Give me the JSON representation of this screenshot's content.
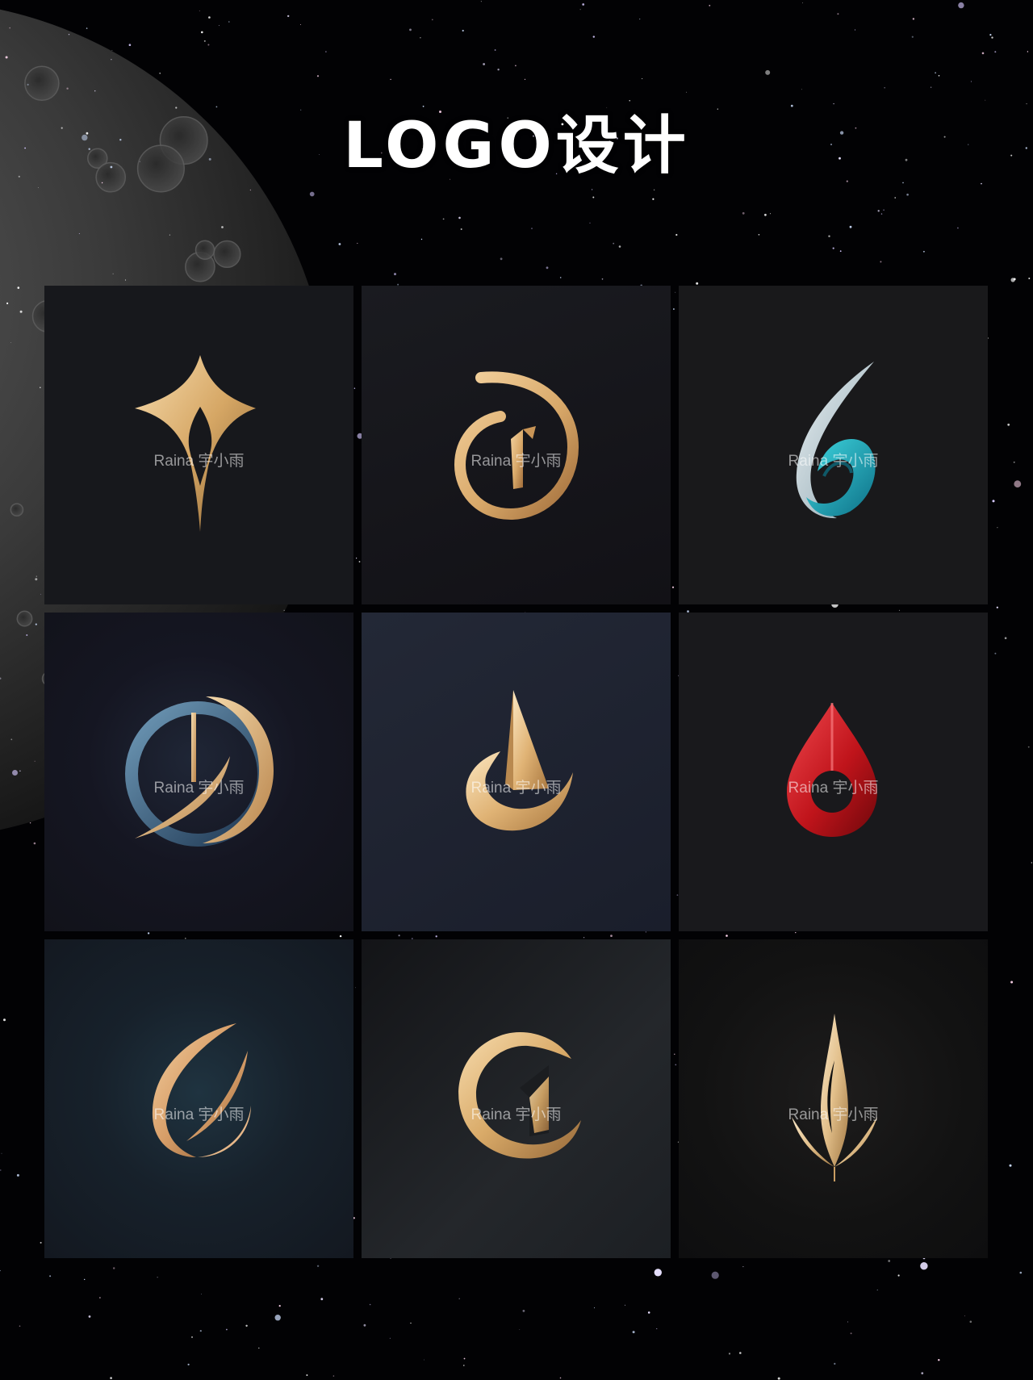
{
  "page": {
    "title": "LOGO设计",
    "watermark": "Raina 宇小雨"
  },
  "colors": {
    "background": "#020204",
    "title": "#ffffff",
    "gold": "#e2b67a",
    "teal": "#1fb3c0",
    "steel_blue": "#3f6a86",
    "red": "#c0141b"
  },
  "logos": [
    {
      "icon": "gold-diamond-leaf-icon"
    },
    {
      "icon": "gold-spiral-ring-icon"
    },
    {
      "icon": "silver-teal-droplet-icon"
    },
    {
      "icon": "blue-gold-ring-slash-icon"
    },
    {
      "icon": "gold-flag-crescent-icon"
    },
    {
      "icon": "red-droplet-icon"
    },
    {
      "icon": "gold-crescent-leaf-icon"
    },
    {
      "icon": "gold-c-ring-icon"
    },
    {
      "icon": "gold-flame-lotus-icon"
    }
  ]
}
